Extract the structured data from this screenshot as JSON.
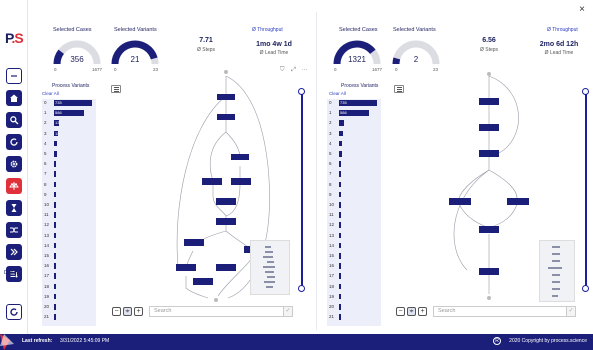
{
  "window": {
    "close_glyph": "×"
  },
  "brand": {
    "logo_text": "P",
    "logo_dot": ".S"
  },
  "rail": {
    "items": [
      {
        "icon": "minus-icon"
      },
      {
        "icon": "home-icon"
      },
      {
        "icon": "search-icon"
      },
      {
        "icon": "refresh-icon"
      },
      {
        "icon": "gear-icon"
      },
      {
        "icon": "balance-icon"
      },
      {
        "icon": "hourglass-icon"
      },
      {
        "icon": "shuffle-icon"
      },
      {
        "icon": "double-chevron-right-icon"
      },
      {
        "icon": "list-filter-icon"
      }
    ],
    "more_label": "Drilld..."
  },
  "left_panel": {
    "selected_cases": {
      "label": "Selected Cases",
      "value": "356",
      "min": "0",
      "max": "1677",
      "fraction": 0.21
    },
    "selected_variants": {
      "label": "Selected Variants",
      "value": "21",
      "min": "0",
      "max": "23",
      "fraction": 0.91
    },
    "steps": {
      "value": "7.71",
      "label": "Ø Steps"
    },
    "throughput": {
      "link": "Ø Throughput",
      "value": "1mo 4w 1d",
      "label": "Ø Lead Time"
    },
    "process_variants": {
      "title": "Process Variants",
      "clear_all": "Clear All",
      "rows": [
        {
          "idx": "0",
          "bar_label": "735",
          "fraction": 0.95
        },
        {
          "idx": "1",
          "bar_label": "586",
          "fraction": 0.76
        },
        {
          "idx": "2",
          "bar_label": "13",
          "fraction": 0.13
        },
        {
          "idx": "3",
          "bar_label": "11",
          "fraction": 0.11
        },
        {
          "idx": "4",
          "bar_label": "",
          "fraction": 0.08
        },
        {
          "idx": "5",
          "bar_label": "",
          "fraction": 0.07
        },
        {
          "idx": "6",
          "bar_label": "",
          "fraction": 0.05
        },
        {
          "idx": "7",
          "bar_label": "",
          "fraction": 0.04
        },
        {
          "idx": "8",
          "bar_label": "",
          "fraction": 0.035
        },
        {
          "idx": "9",
          "bar_label": "",
          "fraction": 0.03
        },
        {
          "idx": "10",
          "bar_label": "",
          "fraction": 0.03
        },
        {
          "idx": "11",
          "bar_label": "",
          "fraction": 0.025
        },
        {
          "idx": "12",
          "bar_label": "",
          "fraction": 0.025
        },
        {
          "idx": "13",
          "bar_label": "",
          "fraction": 0.02
        },
        {
          "idx": "14",
          "bar_label": "",
          "fraction": 0.02
        },
        {
          "idx": "15",
          "bar_label": "",
          "fraction": 0.02
        },
        {
          "idx": "16",
          "bar_label": "",
          "fraction": 0.02
        },
        {
          "idx": "17",
          "bar_label": "",
          "fraction": 0.015
        },
        {
          "idx": "18",
          "bar_label": "",
          "fraction": 0.015
        },
        {
          "idx": "19",
          "bar_label": "",
          "fraction": 0.015
        },
        {
          "idx": "20",
          "bar_label": "",
          "fraction": 0.015
        },
        {
          "idx": "21",
          "bar_label": "",
          "fraction": 0.015
        }
      ]
    },
    "search_placeholder": "Search",
    "zoom": {
      "minus": "−",
      "fit": "⌖",
      "plus": "+"
    },
    "graph_tools": {
      "filter": "⛉",
      "expand": "⤢",
      "more": "···"
    }
  },
  "right_panel": {
    "selected_cases": {
      "label": "Selected Cases",
      "value": "1321",
      "min": "0",
      "max": "1677",
      "fraction": 0.79
    },
    "selected_variants": {
      "label": "Selected Variants",
      "value": "2",
      "min": "0",
      "max": "23",
      "fraction": 0.09
    },
    "steps": {
      "value": "6.56",
      "label": "Ø Steps"
    },
    "throughput": {
      "link": "Ø Throughput",
      "value": "2mo 6d 12h",
      "label": "Ø Lead Time"
    },
    "process_variants": {
      "title": "Process Variants",
      "clear_all": "Clear All",
      "rows": [
        {
          "idx": "0",
          "bar_label": "735",
          "fraction": 0.95
        },
        {
          "idx": "1",
          "bar_label": "586",
          "fraction": 0.76
        },
        {
          "idx": "2",
          "bar_label": "",
          "fraction": 0.13
        },
        {
          "idx": "3",
          "bar_label": "",
          "fraction": 0.11
        },
        {
          "idx": "4",
          "bar_label": "",
          "fraction": 0.08
        },
        {
          "idx": "5",
          "bar_label": "",
          "fraction": 0.07
        },
        {
          "idx": "6",
          "bar_label": "",
          "fraction": 0.05
        },
        {
          "idx": "7",
          "bar_label": "",
          "fraction": 0.04
        },
        {
          "idx": "8",
          "bar_label": "",
          "fraction": 0.035
        },
        {
          "idx": "9",
          "bar_label": "",
          "fraction": 0.03
        },
        {
          "idx": "10",
          "bar_label": "",
          "fraction": 0.03
        },
        {
          "idx": "11",
          "bar_label": "",
          "fraction": 0.025
        },
        {
          "idx": "12",
          "bar_label": "",
          "fraction": 0.025
        },
        {
          "idx": "13",
          "bar_label": "",
          "fraction": 0.02
        },
        {
          "idx": "14",
          "bar_label": "",
          "fraction": 0.02
        },
        {
          "idx": "15",
          "bar_label": "",
          "fraction": 0.02
        },
        {
          "idx": "16",
          "bar_label": "",
          "fraction": 0.02
        },
        {
          "idx": "17",
          "bar_label": "",
          "fraction": 0.015
        },
        {
          "idx": "18",
          "bar_label": "",
          "fraction": 0.015
        },
        {
          "idx": "19",
          "bar_label": "",
          "fraction": 0.015
        },
        {
          "idx": "20",
          "bar_label": "",
          "fraction": 0.015
        },
        {
          "idx": "21",
          "bar_label": "",
          "fraction": 0.015
        }
      ]
    },
    "search_placeholder": "Search",
    "zoom": {
      "minus": "−",
      "fit": "⌖",
      "plus": "+"
    }
  },
  "footer": {
    "last_refresh_label": "Last refresh:",
    "last_refresh_value": "3/31/2022 5:45:09 PM",
    "copyright_icon": "R",
    "copyright": "2020 Copyright by process.science"
  },
  "colors": {
    "brand_navy": "#1b1f7a",
    "accent_red": "#e0303a",
    "link_blue": "#2a3cc4",
    "panel_tint": "#eceef9"
  }
}
